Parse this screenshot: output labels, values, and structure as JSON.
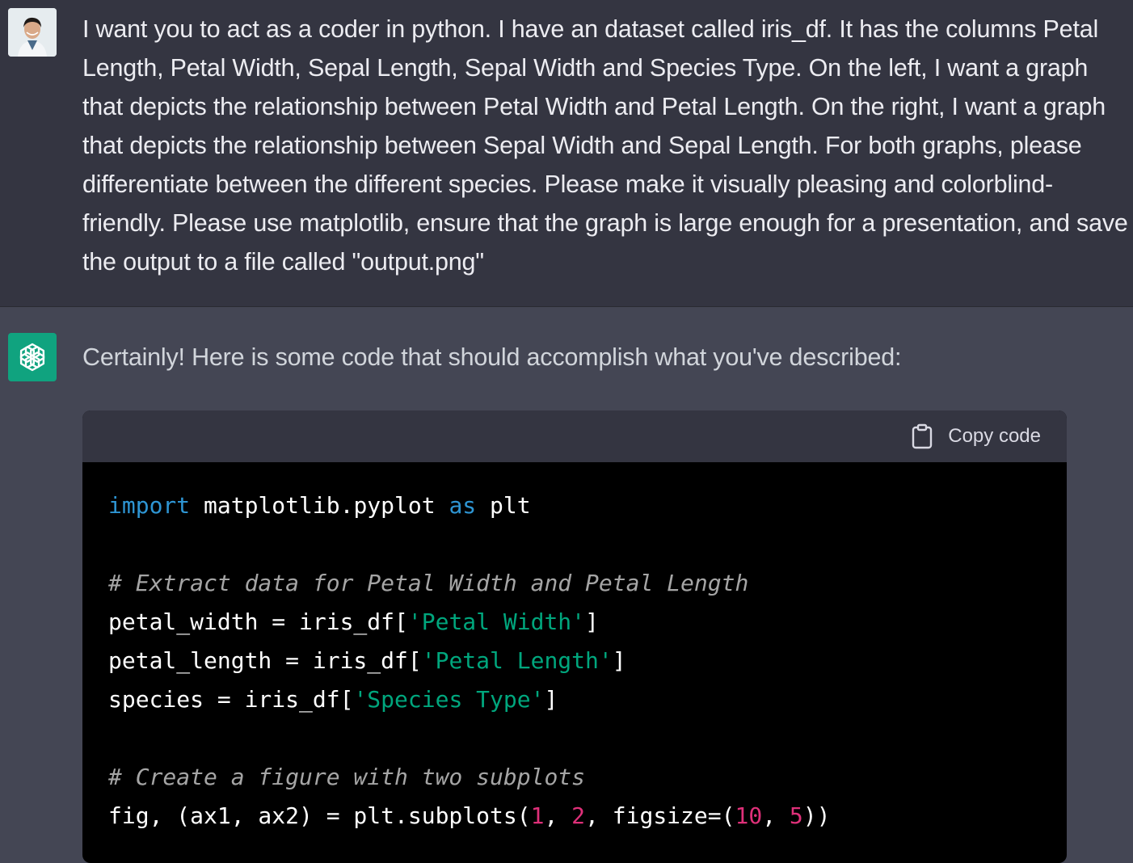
{
  "user_message": {
    "avatar": "user-avatar-photo",
    "text": "I want you to act as a coder in python. I have an dataset called iris_df. It has the columns Petal Length, Petal Width, Sepal Length, Sepal Width and Species Type. On the left, I want a graph that depicts the relationship between Petal Width and Petal Length. On the right, I want a graph that depicts the relationship between Sepal Width and Sepal Length. For both graphs, please differentiate between the different species. Please make it visually pleasing and colorblind-friendly. Please use matplotlib, ensure that the graph is large enough for a presentation, and save the output to a file called \"output.png\""
  },
  "assistant_message": {
    "avatar": "openai-logo-icon",
    "intro": "Certainly! Here is some code that should accomplish what you've described:",
    "code_block": {
      "copy_icon": "clipboard-icon",
      "copy_label": "Copy code",
      "lines": {
        "l1": {
          "kw1": "import",
          "t1": " matplotlib.pyplot ",
          "kw2": "as",
          "t2": " plt"
        },
        "l3": {
          "comment": "# Extract data for Petal Width and Petal Length"
        },
        "l4": {
          "t1": "petal_width = iris_df[",
          "s1": "'Petal Width'",
          "t2": "]"
        },
        "l5": {
          "t1": "petal_length = iris_df[",
          "s1": "'Petal Length'",
          "t2": "]"
        },
        "l6": {
          "t1": "species = iris_df[",
          "s1": "'Species Type'",
          "t2": "]"
        },
        "l8": {
          "comment": "# Create a figure with two subplots"
        },
        "l9": {
          "t1": "fig, (ax1, ax2) = plt.subplots(",
          "n1": "1",
          "c1": ", ",
          "n2": "2",
          "c2": ", figsize=(",
          "n3": "10",
          "c3": ", ",
          "n4": "5",
          "t2": "))"
        }
      }
    }
  },
  "colors": {
    "user_bg": "#343541",
    "assistant_bg": "#444654",
    "code_bg": "#000000",
    "keyword": "#2e95d3",
    "string": "#00a67d",
    "number": "#df3079",
    "comment": "#a5a5a5",
    "brand": "#10a37f"
  }
}
